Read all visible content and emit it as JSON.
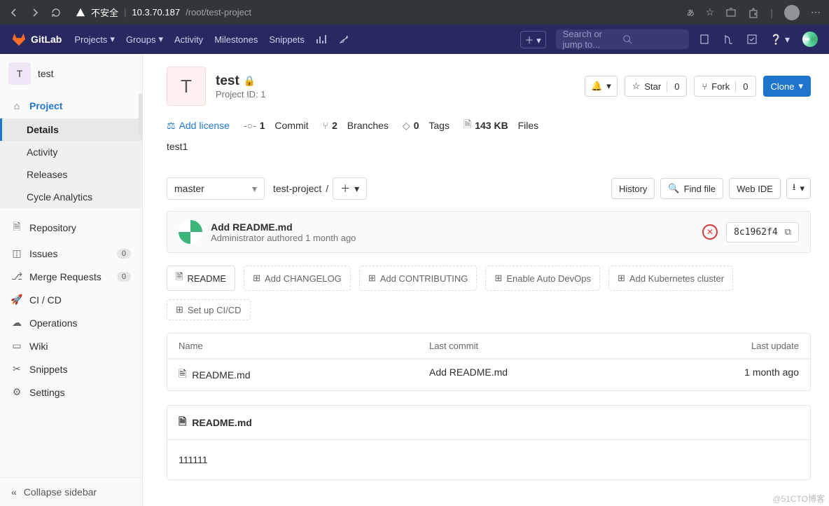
{
  "browser": {
    "security_label": "不安全",
    "url_host": "10.3.70.187",
    "url_path": "/root/test-project",
    "lang_badge": "あ"
  },
  "header": {
    "brand": "GitLab",
    "nav": {
      "projects": "Projects",
      "groups": "Groups",
      "activity": "Activity",
      "milestones": "Milestones",
      "snippets": "Snippets"
    },
    "search_placeholder": "Search or jump to..."
  },
  "sidebar": {
    "project_tile_letter": "T",
    "project_name": "test",
    "project_label": "Project",
    "sub": {
      "details": "Details",
      "activity": "Activity",
      "releases": "Releases",
      "cycle": "Cycle Analytics"
    },
    "items": {
      "repository": "Repository",
      "issues": "Issues",
      "issues_count": "0",
      "merge": "Merge Requests",
      "merge_count": "0",
      "cicd": "CI / CD",
      "operations": "Operations",
      "wiki": "Wiki",
      "snippets": "Snippets",
      "settings": "Settings"
    },
    "collapse": "Collapse sidebar"
  },
  "project": {
    "name": "test",
    "tile_letter": "T",
    "id_label": "Project ID: 1",
    "star_label": "Star",
    "star_count": "0",
    "fork_label": "Fork",
    "fork_count": "0",
    "clone_label": "Clone",
    "description": "test1"
  },
  "stats": {
    "add_license": "Add license",
    "commits_count": "1",
    "commits_label": "Commit",
    "branches_count": "2",
    "branches_label": "Branches",
    "tags_count": "0",
    "tags_label": "Tags",
    "size_value": "143 KB",
    "size_label": "Files"
  },
  "files": {
    "branch": "master",
    "breadcrumb_root": "test-project",
    "history": "History",
    "find_file": "Find file",
    "web_ide": "Web IDE"
  },
  "commit": {
    "title": "Add README.md",
    "author": "Administrator",
    "authored": "authored 1 month ago",
    "sha": "8c1962f4"
  },
  "chips": {
    "readme": "README",
    "changelog": "Add CHANGELOG",
    "contributing": "Add CONTRIBUTING",
    "autodevops": "Enable Auto DevOps",
    "kubernetes": "Add Kubernetes cluster",
    "cicd": "Set up CI/CD"
  },
  "table": {
    "head_name": "Name",
    "head_commit": "Last commit",
    "head_update": "Last update",
    "rows": [
      {
        "name": "README.md",
        "commit": "Add README.md",
        "update": "1 month ago"
      }
    ]
  },
  "readme": {
    "filename": "README.md",
    "content": "111111"
  },
  "watermark": "@51CTO博客"
}
